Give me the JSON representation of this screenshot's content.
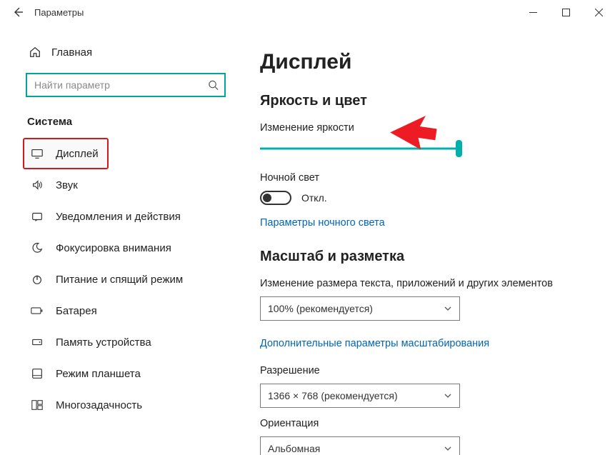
{
  "window": {
    "title": "Параметры"
  },
  "sidebar": {
    "home": "Главная",
    "searchPlaceholder": "Найти параметр",
    "section": "Система",
    "items": [
      {
        "label": "Дисплей"
      },
      {
        "label": "Звук"
      },
      {
        "label": "Уведомления и действия"
      },
      {
        "label": "Фокусировка внимания"
      },
      {
        "label": "Питание и спящий режим"
      },
      {
        "label": "Батарея"
      },
      {
        "label": "Память устройства"
      },
      {
        "label": "Режим планшета"
      },
      {
        "label": "Многозадачность"
      }
    ]
  },
  "main": {
    "title": "Дисплей",
    "brightnessGroup": "Яркость и цвет",
    "brightnessLabel": "Изменение яркости",
    "nightLightLabel": "Ночной свет",
    "toggleState": "Откл.",
    "nightLightLink": "Параметры ночного света",
    "scaleGroup": "Масштаб и разметка",
    "scaleLabel": "Изменение размера текста, приложений и других элементов",
    "scaleValue": "100% (рекомендуется)",
    "scaleAdvancedLink": "Дополнительные параметры масштабирования",
    "resolutionLabel": "Разрешение",
    "resolutionValue": "1366 × 768 (рекомендуется)",
    "orientationLabel": "Ориентация",
    "orientationValue": "Альбомная"
  }
}
